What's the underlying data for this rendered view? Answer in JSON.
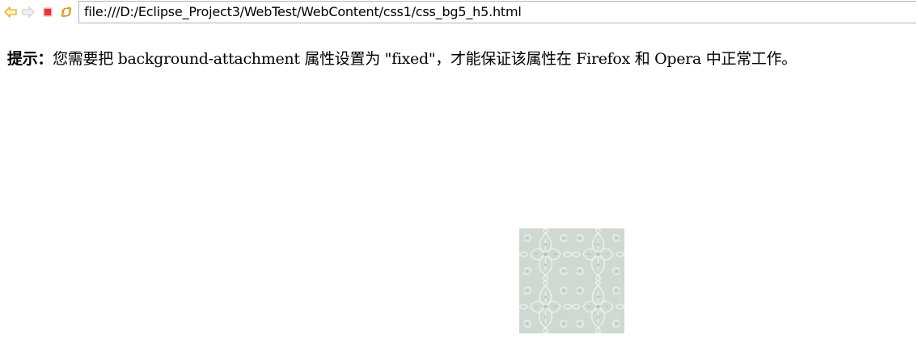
{
  "browser": {
    "url": "file:///D:/Eclipse_Project3/WebTest/WebContent/css1/css_bg5_h5.html",
    "icons": [
      "back-arrow-icon",
      "forward-arrow-icon",
      "stop-icon",
      "refresh-icon"
    ],
    "colors": {
      "back": "#e8a92a",
      "forward": "#d8d8d8",
      "stop": "#e03030",
      "refresh": "#e8a92a"
    }
  },
  "page": {
    "tip_label": "提示：",
    "tip_text": "您需要把 background-attachment 属性设置为 \"fixed\"，才能保证该属性在 Firefox 和 Opera 中正常工作。",
    "background_image": "damask-pattern-tile",
    "tile_color": "#cdd6cf"
  }
}
